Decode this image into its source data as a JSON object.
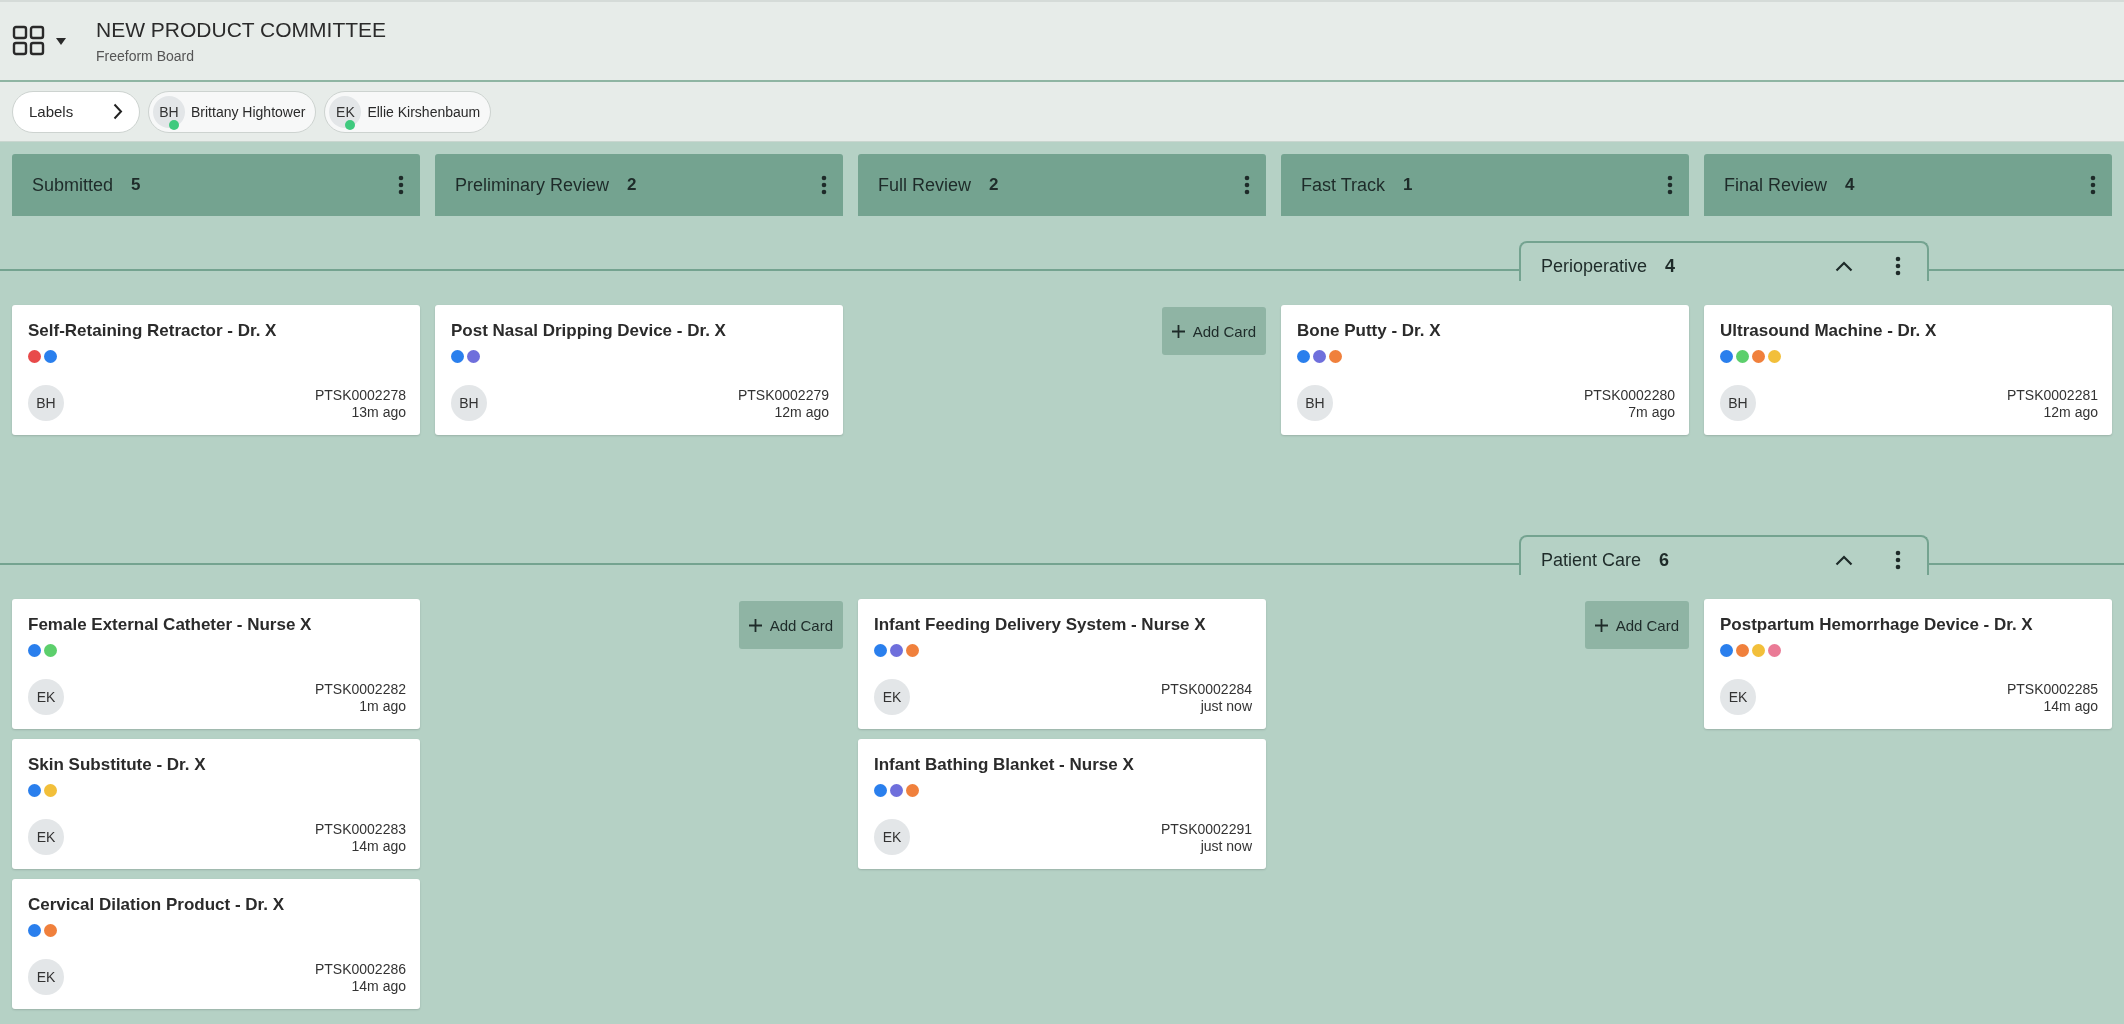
{
  "header": {
    "title": "NEW PRODUCT COMMITTEE",
    "subtitle": "Freeform Board"
  },
  "filters": {
    "labels_button": "Labels",
    "users": [
      {
        "initials": "BH",
        "name": "Brittany Hightower",
        "online": true
      },
      {
        "initials": "EK",
        "name": "Ellie Kirshenbaum",
        "online": true
      }
    ]
  },
  "columns": [
    {
      "title": "Submitted",
      "count": "5"
    },
    {
      "title": "Preliminary Review",
      "count": "2"
    },
    {
      "title": "Full Review",
      "count": "2"
    },
    {
      "title": "Fast Track",
      "count": "1"
    },
    {
      "title": "Final Review",
      "count": "4"
    }
  ],
  "lanes": [
    {
      "title": "Perioperative",
      "count": "4",
      "expanded": true,
      "cells": [
        {
          "cards": [
            {
              "title": "Self-Retaining Retractor - Dr. X",
              "labels": [
                {
                  "color": "#e84a4a"
                },
                {
                  "color": "#2a7fed"
                }
              ],
              "assignee": "BH",
              "number": "PTSK0002278",
              "time": "13m ago"
            }
          ]
        },
        {
          "cards": [
            {
              "title": "Post Nasal Dripping Device - Dr. X",
              "labels": [
                {
                  "color": "#2a7fed"
                },
                {
                  "color": "#6f6fdc"
                }
              ],
              "assignee": "BH",
              "number": "PTSK0002279",
              "time": "12m ago"
            }
          ]
        },
        {
          "add_card": "Add Card"
        },
        {
          "cards": [
            {
              "title": "Bone Putty - Dr. X",
              "labels": [
                {
                  "color": "#2a7fed"
                },
                {
                  "color": "#6f6fdc"
                },
                {
                  "color": "#f0803c"
                }
              ],
              "assignee": "BH",
              "number": "PTSK0002280",
              "time": "7m ago"
            }
          ]
        },
        {
          "cards": [
            {
              "title": "Ultrasound Machine - Dr. X",
              "labels": [
                {
                  "color": "#2a7fed"
                },
                {
                  "color": "#5ccf6c"
                },
                {
                  "color": "#f0803c"
                },
                {
                  "color": "#f2bf3a"
                }
              ],
              "assignee": "BH",
              "number": "PTSK0002281",
              "time": "12m ago"
            }
          ]
        }
      ]
    },
    {
      "title": "Patient Care",
      "count": "6",
      "expanded": true,
      "cells": [
        {
          "cards": [
            {
              "title": "Female External Catheter - Nurse X",
              "labels": [
                {
                  "color": "#2a7fed"
                },
                {
                  "color": "#5ccf6c"
                }
              ],
              "assignee": "EK",
              "number": "PTSK0002282",
              "time": "1m ago"
            },
            {
              "title": "Skin Substitute - Dr. X",
              "labels": [
                {
                  "color": "#2a7fed"
                },
                {
                  "color": "#f2bf3a"
                }
              ],
              "assignee": "EK",
              "number": "PTSK0002283",
              "time": "14m ago"
            },
            {
              "title": "Cervical Dilation Product - Dr. X",
              "labels": [
                {
                  "color": "#2a7fed"
                },
                {
                  "color": "#f0803c"
                }
              ],
              "assignee": "EK",
              "number": "PTSK0002286",
              "time": "14m ago"
            }
          ]
        },
        {
          "add_card": "Add Card"
        },
        {
          "cards": [
            {
              "title": "Infant Feeding Delivery System - Nurse X",
              "labels": [
                {
                  "color": "#2a7fed"
                },
                {
                  "color": "#6f6fdc"
                },
                {
                  "color": "#f0803c"
                }
              ],
              "assignee": "EK",
              "number": "PTSK0002284",
              "time": "just now"
            },
            {
              "title": "Infant Bathing Blanket - Nurse X",
              "labels": [
                {
                  "color": "#2a7fed"
                },
                {
                  "color": "#6f6fdc"
                },
                {
                  "color": "#f0803c"
                }
              ],
              "assignee": "EK",
              "number": "PTSK0002291",
              "time": "just now"
            }
          ]
        },
        {
          "add_card": "Add Card"
        },
        {
          "cards": [
            {
              "title": "Postpartum Hemorrhage Device - Dr. X",
              "labels": [
                {
                  "color": "#2a7fed"
                },
                {
                  "color": "#f0803c"
                },
                {
                  "color": "#f2bf3a"
                },
                {
                  "color": "#ea7b96"
                }
              ],
              "assignee": "EK",
              "number": "PTSK0002285",
              "time": "14m ago"
            }
          ]
        }
      ]
    }
  ]
}
